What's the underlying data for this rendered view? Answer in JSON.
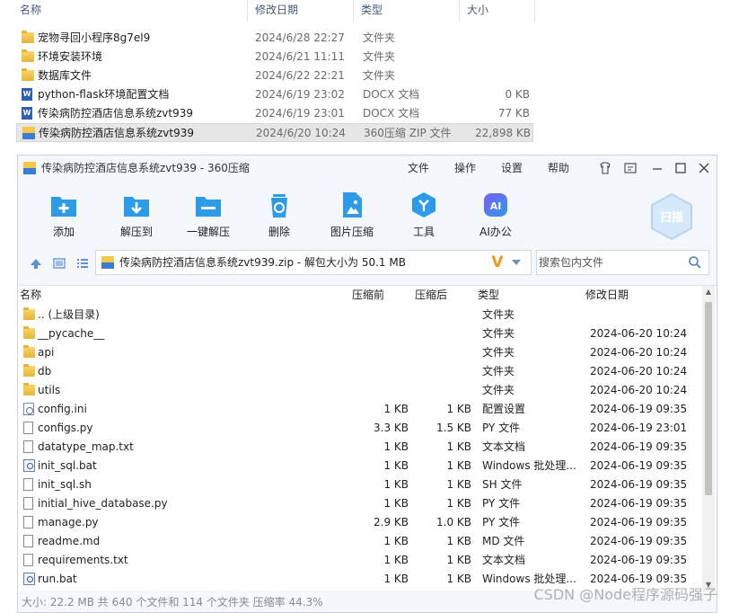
{
  "explorer": {
    "columns": {
      "name": "名称",
      "date": "修改日期",
      "type": "类型",
      "size": "大小"
    },
    "rows": [
      {
        "icon": "folder-icon",
        "name": "宠物寻回小程序8g7el9",
        "date": "2024/6/28 22:27",
        "type": "文件夹",
        "size": ""
      },
      {
        "icon": "folder-icon",
        "name": "环境安装环境",
        "date": "2024/6/21 11:11",
        "type": "文件夹",
        "size": ""
      },
      {
        "icon": "folder-icon",
        "name": "数据库文件",
        "date": "2024/6/22 22:21",
        "type": "文件夹",
        "size": ""
      },
      {
        "icon": "word-doc-icon",
        "name": "python-flask环境配置文档",
        "date": "2024/6/19 23:02",
        "type": "DOCX 文档",
        "size": "0 KB"
      },
      {
        "icon": "word-doc-icon",
        "name": "传染病防控酒店信息系统zvt939",
        "date": "2024/6/19 23:01",
        "type": "DOCX 文档",
        "size": "77 KB"
      },
      {
        "icon": "zip-archive-icon",
        "name": "传染病防控酒店信息系统zvt939",
        "date": "2024/6/20 10:24",
        "type": "360压缩 ZIP 文件",
        "size": "22,898 KB",
        "selected": true
      }
    ]
  },
  "zipwin": {
    "title": "传染病防控酒店信息系统zvt939 - 360压缩",
    "menu": [
      "文件",
      "操作",
      "设置",
      "帮助"
    ],
    "toolbar": [
      {
        "icon": "add-icon",
        "label": "添加"
      },
      {
        "icon": "extract-to-icon",
        "label": "解压到"
      },
      {
        "icon": "one-click-extract-icon",
        "label": "一键解压"
      },
      {
        "icon": "delete-icon",
        "label": "删除"
      },
      {
        "icon": "image-compress-icon",
        "label": "图片压缩"
      },
      {
        "icon": "tools-icon",
        "label": "工具"
      },
      {
        "icon": "ai-office-icon",
        "label": "AI办公"
      }
    ],
    "scan_label": "扫描",
    "address": "传染病防控酒店信息系统zvt939.zip - 解包大小为 50.1 MB",
    "address_badge": "V",
    "search_placeholder": "搜索包内文件",
    "columns": {
      "name": "名称",
      "orig": "压缩前",
      "comp": "压缩后",
      "type": "类型",
      "date": "修改日期"
    },
    "files": [
      {
        "kind": "folder",
        "name": ".. (上级目录)",
        "orig": "",
        "comp": "",
        "type": "文件夹",
        "date": ""
      },
      {
        "kind": "folder",
        "name": "__pycache__",
        "orig": "",
        "comp": "",
        "type": "文件夹",
        "date": "2024-06-20 10:24"
      },
      {
        "kind": "folder",
        "name": "api",
        "orig": "",
        "comp": "",
        "type": "文件夹",
        "date": "2024-06-20 10:24"
      },
      {
        "kind": "folder",
        "name": "db",
        "orig": "",
        "comp": "",
        "type": "文件夹",
        "date": "2024-06-20 10:24"
      },
      {
        "kind": "folder",
        "name": "utils",
        "orig": "",
        "comp": "",
        "type": "文件夹",
        "date": "2024-06-20 10:24"
      },
      {
        "kind": "cfg",
        "name": "config.ini",
        "orig": "1 KB",
        "comp": "1 KB",
        "type": "配置设置",
        "date": "2024-06-19 09:35"
      },
      {
        "kind": "file",
        "name": "configs.py",
        "orig": "3.3 KB",
        "comp": "1.5 KB",
        "type": "PY 文件",
        "date": "2024-06-19 23:01"
      },
      {
        "kind": "file",
        "name": "datatype_map.txt",
        "orig": "1 KB",
        "comp": "1 KB",
        "type": "文本文档",
        "date": "2024-06-19 09:35"
      },
      {
        "kind": "bat",
        "name": "init_sql.bat",
        "orig": "1 KB",
        "comp": "1 KB",
        "type": "Windows 批处理...",
        "date": "2024-06-19 09:35"
      },
      {
        "kind": "file",
        "name": "init_sql.sh",
        "orig": "1 KB",
        "comp": "1 KB",
        "type": "SH 文件",
        "date": "2024-06-19 09:35"
      },
      {
        "kind": "file",
        "name": "initial_hive_database.py",
        "orig": "1 KB",
        "comp": "1 KB",
        "type": "PY 文件",
        "date": "2024-06-19 09:35"
      },
      {
        "kind": "file",
        "name": "manage.py",
        "orig": "2.9 KB",
        "comp": "1.0 KB",
        "type": "PY 文件",
        "date": "2024-06-19 09:35"
      },
      {
        "kind": "file",
        "name": "readme.md",
        "orig": "1 KB",
        "comp": "1 KB",
        "type": "MD 文件",
        "date": "2024-06-19 09:35"
      },
      {
        "kind": "file",
        "name": "requirements.txt",
        "orig": "1 KB",
        "comp": "1 KB",
        "type": "文本文档",
        "date": "2024-06-19 09:35"
      },
      {
        "kind": "bat",
        "name": "run.bat",
        "orig": "1 KB",
        "comp": "1 KB",
        "type": "Windows 批处理...",
        "date": "2024-06-19 09:35"
      }
    ],
    "status": "大小: 22.2 MB 共 640 个文件和 114 个文件夹 压缩率 44.3%"
  },
  "watermark": "CSDN @Node程序源码强子",
  "colors": {
    "accent": "#2d8cf0",
    "toolbar_icon": "#2d9be8",
    "title_bg": "#f4f7fb",
    "address_badge": "#f29a1a"
  }
}
